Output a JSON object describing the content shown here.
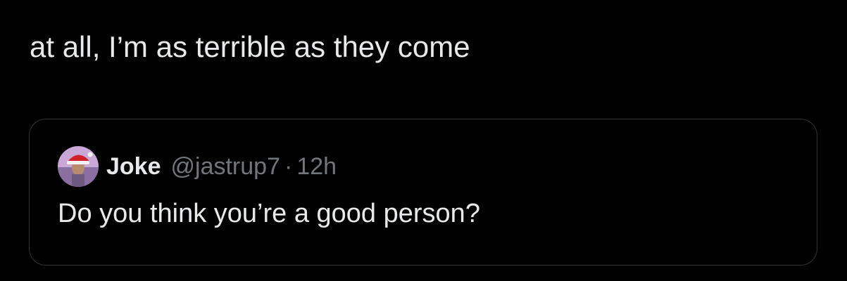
{
  "tweet": {
    "text": "at all, I’m as terrible as they come"
  },
  "quoted_tweet": {
    "display_name": "Joke",
    "handle": "@jastrup7",
    "separator": "·",
    "time": "12h",
    "text": "Do you think you’re a good person?",
    "avatar_icon": "profile-photo-santa-hat"
  },
  "colors": {
    "background": "#000000",
    "text_primary": "#e7e9ea",
    "text_secondary": "#71767b",
    "border": "#2f3336"
  }
}
